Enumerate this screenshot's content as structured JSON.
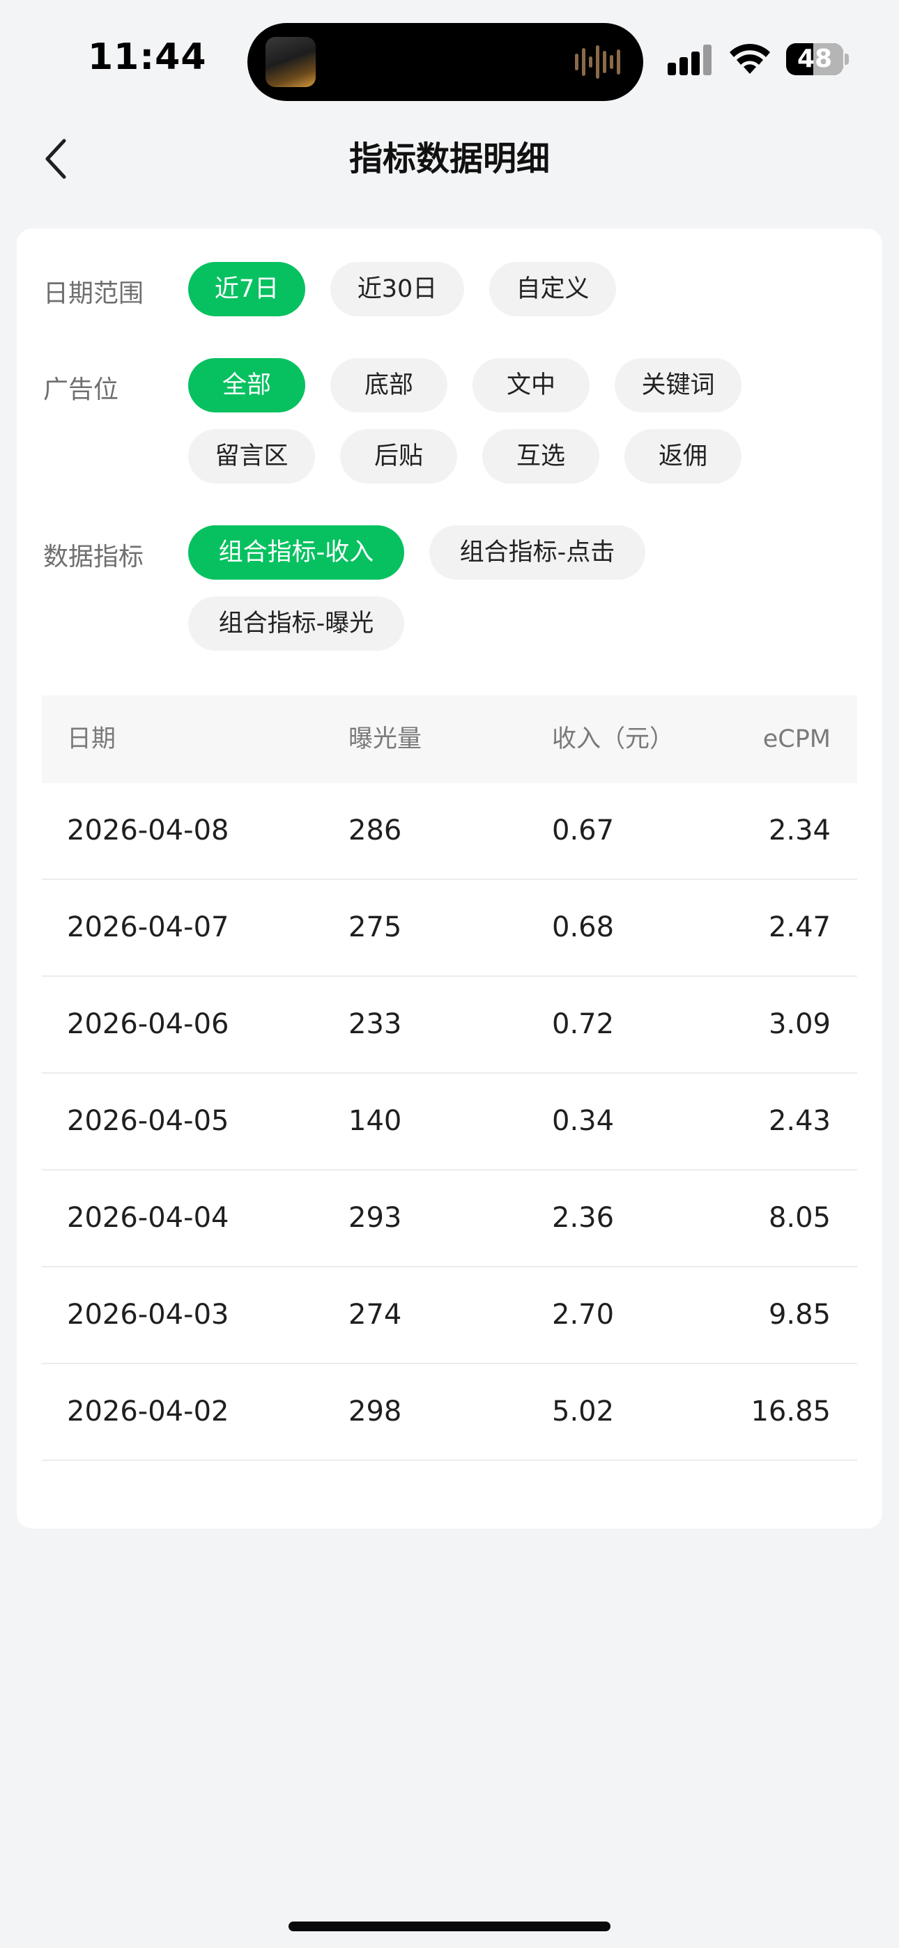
{
  "status_bar": {
    "time": "11:44",
    "battery": "48",
    "battery_level": 0.48
  },
  "header": {
    "title": "指标数据明细"
  },
  "filters": {
    "date_range": {
      "label": "日期范围",
      "options": [
        "近7日",
        "近30日",
        "自定义"
      ],
      "selected": 0
    },
    "ad_slot": {
      "label": "广告位",
      "options": [
        "全部",
        "底部",
        "文中",
        "关键词",
        "留言区",
        "后贴",
        "互选",
        "返佣"
      ],
      "selected": 0
    },
    "metric": {
      "label": "数据指标",
      "options": [
        "组合指标-收入",
        "组合指标-点击",
        "组合指标-曝光"
      ],
      "selected": 0
    }
  },
  "table": {
    "columns": [
      "日期",
      "曝光量",
      "收入（元）",
      "eCPM"
    ],
    "rows": [
      [
        "2026-04-08",
        "286",
        "0.67",
        "2.34"
      ],
      [
        "2026-04-07",
        "275",
        "0.68",
        "2.47"
      ],
      [
        "2026-04-06",
        "233",
        "0.72",
        "3.09"
      ],
      [
        "2026-04-05",
        "140",
        "0.34",
        "2.43"
      ],
      [
        "2026-04-04",
        "293",
        "2.36",
        "8.05"
      ],
      [
        "2026-04-03",
        "274",
        "2.70",
        "9.85"
      ],
      [
        "2026-04-02",
        "298",
        "5.02",
        "16.85"
      ]
    ]
  },
  "colors": {
    "accent": "#07C160",
    "background": "#F3F4F6",
    "card": "#FFFFFF"
  }
}
